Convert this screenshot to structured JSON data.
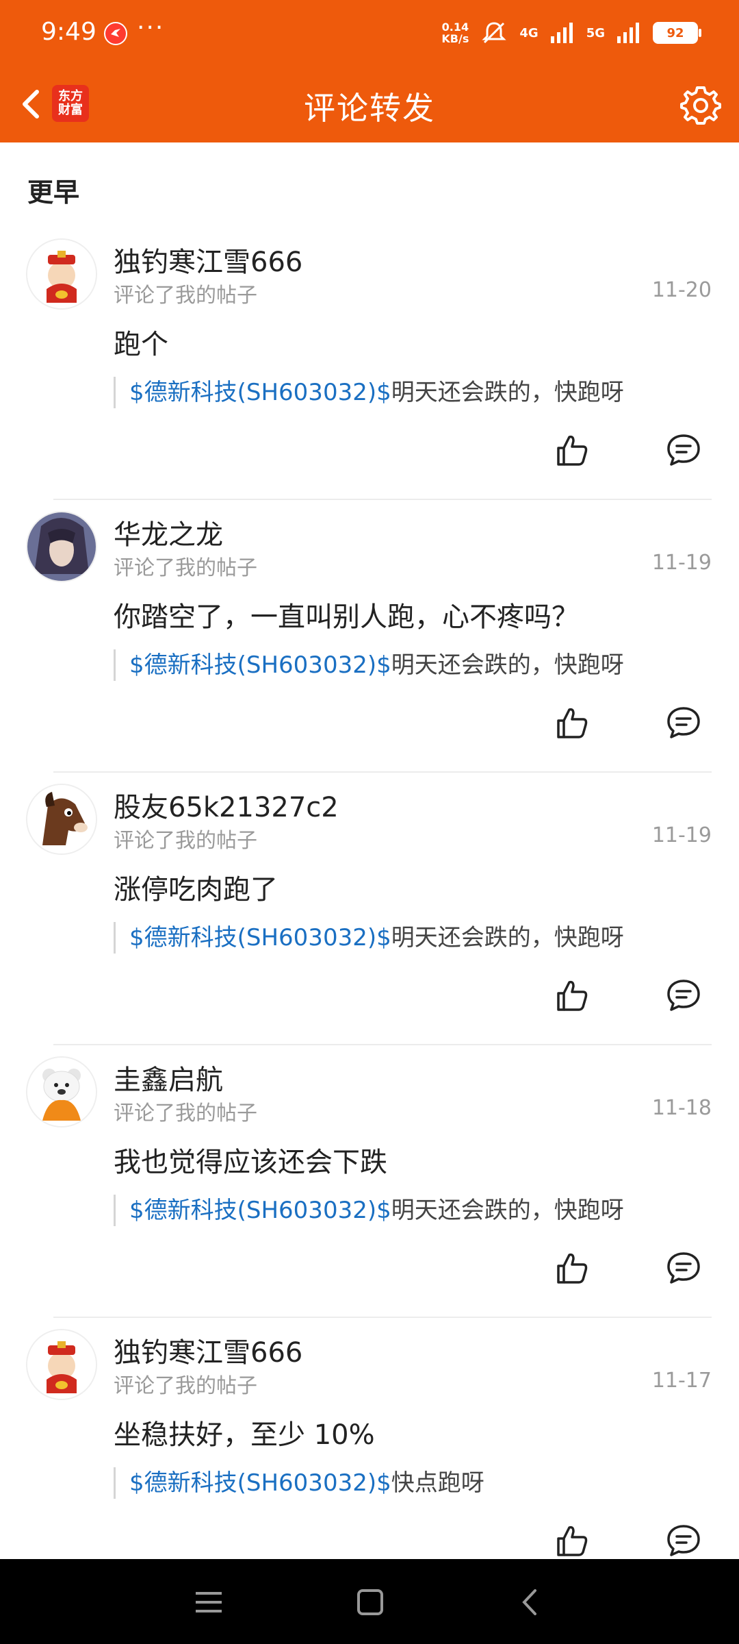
{
  "status_bar": {
    "time": "9:49",
    "more": "···",
    "net_speed_value": "0.14",
    "net_speed_unit": "KB/s",
    "net1": "4G",
    "net2": "5G",
    "battery": "92"
  },
  "header": {
    "title": "评论转发",
    "logo_line1": "东方",
    "logo_line2": "财富",
    "accent": "#ee5a0c"
  },
  "section_title": "更早",
  "comments": [
    {
      "user": "独钓寒江雪666",
      "action": "评论了我的帖子",
      "date": "11-20",
      "text": "跑个",
      "stock": "$德新科技(SH603032)$",
      "quote": "明天还会跌的，快跑呀",
      "avatar": "god-of-wealth-avatar"
    },
    {
      "user": "华龙之龙",
      "action": "评论了我的帖子",
      "date": "11-19",
      "text": "你踏空了，一直叫别人跑，心不疼吗？",
      "stock": "$德新科技(SH603032)$",
      "quote": "明天还会跌的，快跑呀",
      "avatar": "anime-warrior-avatar"
    },
    {
      "user": "股友65k21327c2",
      "action": "评论了我的帖子",
      "date": "11-19",
      "text": "涨停吃肉跑了",
      "stock": "$德新科技(SH603032)$",
      "quote": "明天还会跌的，快跑呀",
      "avatar": "horse-avatar"
    },
    {
      "user": "圭鑫启航",
      "action": "评论了我的帖子",
      "date": "11-18",
      "text": "我也觉得应该还会下跌",
      "stock": "$德新科技(SH603032)$",
      "quote": "明天还会跌的，快跑呀",
      "avatar": "bear-avatar"
    },
    {
      "user": "独钓寒江雪666",
      "action": "评论了我的帖子",
      "date": "11-17",
      "text": "坐稳扶好，至少 10%",
      "stock": "$德新科技(SH603032)$",
      "quote": "快点跑呀",
      "avatar": "god-of-wealth-avatar"
    }
  ]
}
